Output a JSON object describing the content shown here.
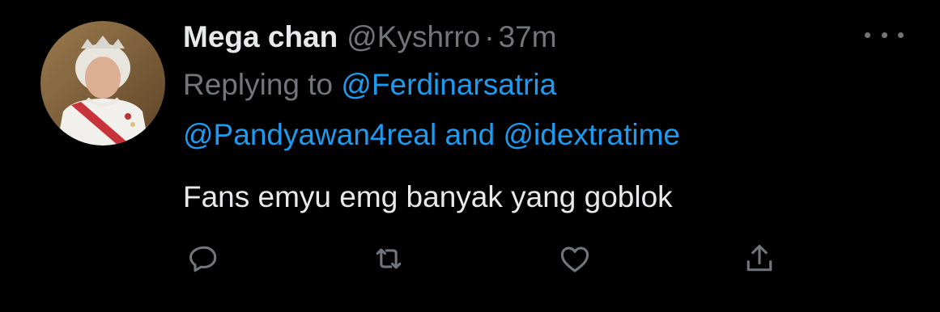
{
  "tweet": {
    "display_name": "Mega chan",
    "handle": "@Kyshrro",
    "separator": "·",
    "time": "37m",
    "replying_prefix": "Replying to",
    "mentions": [
      "@Ferdinarsatria",
      "@Pandyawan4real",
      "@idextratime"
    ],
    "mentions_joiner": "and",
    "text": "Fans emyu emg banyak yang goblok"
  },
  "icons": {
    "more": "more-horizontal-icon",
    "reply": "reply-icon",
    "retweet": "retweet-icon",
    "like": "heart-icon",
    "share": "share-icon"
  },
  "colors": {
    "background": "#000000",
    "primary_text": "#e7e9ea",
    "secondary_text": "#71767b",
    "link": "#1d9bf0"
  }
}
